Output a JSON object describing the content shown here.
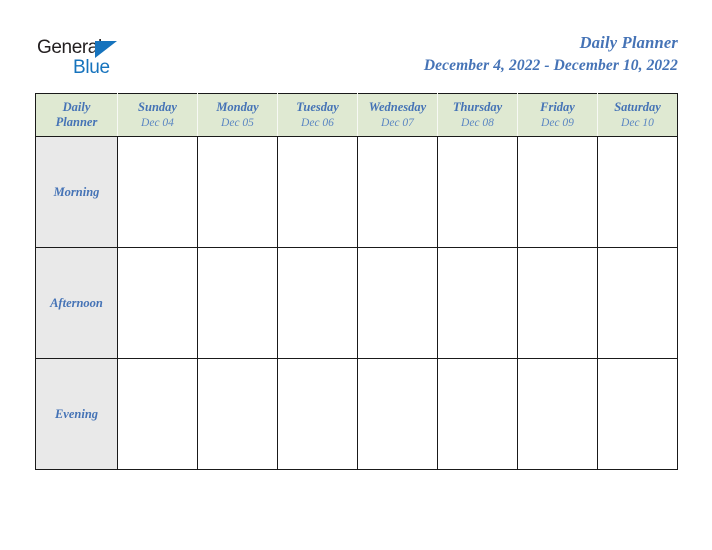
{
  "logo": {
    "word_one": "General",
    "word_two": "Blue",
    "triangle_icon": "triangle-icon",
    "brand_blue": "#1673bd",
    "brand_dark": "#231f20"
  },
  "header": {
    "title": "Daily Planner",
    "date_range": "December 4, 2022 - December 10, 2022",
    "title_color": "#4573b6"
  },
  "table": {
    "corner": {
      "line1": "Daily",
      "line2": "Planner"
    },
    "header_bg": "#dfe9d2",
    "row_label_bg": "#e9e9e9",
    "grid_color": "#1a1a1a",
    "columns": [
      {
        "day": "Sunday",
        "date": "Dec 04"
      },
      {
        "day": "Monday",
        "date": "Dec 05"
      },
      {
        "day": "Tuesday",
        "date": "Dec 06"
      },
      {
        "day": "Wednesday",
        "date": "Dec 07"
      },
      {
        "day": "Thursday",
        "date": "Dec 08"
      },
      {
        "day": "Friday",
        "date": "Dec 09"
      },
      {
        "day": "Saturday",
        "date": "Dec 10"
      }
    ],
    "rows": [
      {
        "label": "Morning",
        "cells": [
          "",
          "",
          "",
          "",
          "",
          "",
          ""
        ]
      },
      {
        "label": "Afternoon",
        "cells": [
          "",
          "",
          "",
          "",
          "",
          "",
          ""
        ]
      },
      {
        "label": "Evening",
        "cells": [
          "",
          "",
          "",
          "",
          "",
          "",
          ""
        ]
      }
    ]
  }
}
